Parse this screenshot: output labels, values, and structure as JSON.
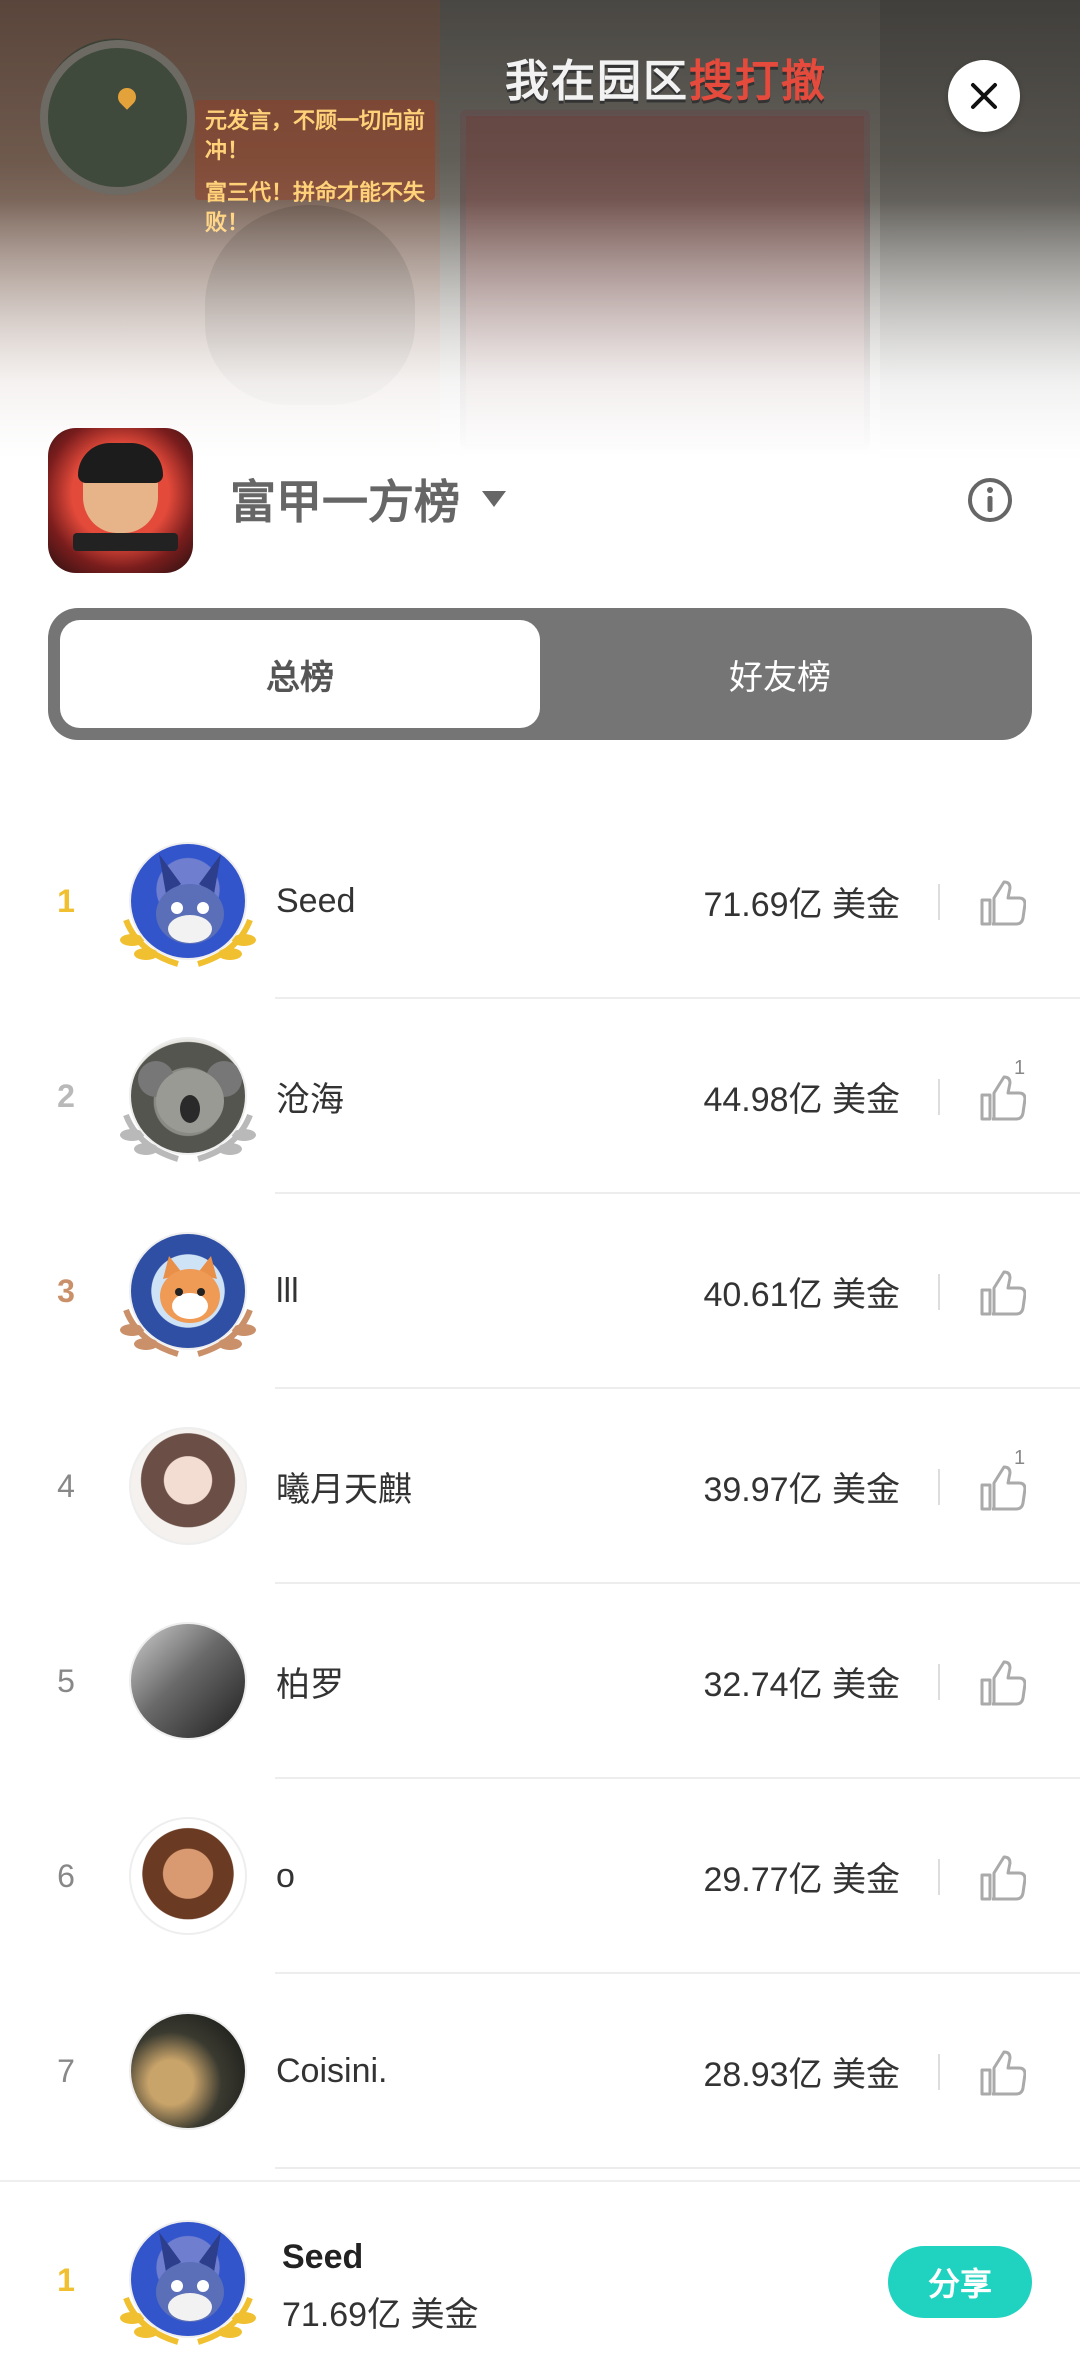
{
  "banner": {
    "title_part1": "我在园区",
    "title_part2": "搜打撤",
    "sign_line1": "元发言，不顾一切向前冲！",
    "sign_line2": "富三代！拼命才能不失败！",
    "close_icon": "close-icon"
  },
  "header": {
    "board_title": "富甲一方榜",
    "dropdown_icon": "caret-down-icon",
    "info_icon": "info-icon"
  },
  "tabs": [
    {
      "label": "总榜",
      "active": true
    },
    {
      "label": "好友榜",
      "active": false
    }
  ],
  "colors": {
    "gold": "#f0c030",
    "silver": "#b9b9b9",
    "bronze": "#c9906a",
    "share_button": "#20d3c0",
    "tab_bar": "#757575"
  },
  "rankings": [
    {
      "rank": "1",
      "name": "Seed",
      "score": "71.69亿 美金",
      "likes": ""
    },
    {
      "rank": "2",
      "name": "沧海",
      "score": "44.98亿 美金",
      "likes": "1"
    },
    {
      "rank": "3",
      "name": "lll",
      "score": "40.61亿 美金",
      "likes": ""
    },
    {
      "rank": "4",
      "name": "曦月天麒",
      "score": "39.97亿 美金",
      "likes": "1"
    },
    {
      "rank": "5",
      "name": "柏罗",
      "score": "32.74亿 美金",
      "likes": ""
    },
    {
      "rank": "6",
      "name": "o",
      "score": "29.77亿 美金",
      "likes": ""
    },
    {
      "rank": "7",
      "name": "Coisini.",
      "score": "28.93亿 美金",
      "likes": ""
    }
  ],
  "me": {
    "rank": "1",
    "name": "Seed",
    "score": "71.69亿 美金",
    "share_label": "分享"
  }
}
